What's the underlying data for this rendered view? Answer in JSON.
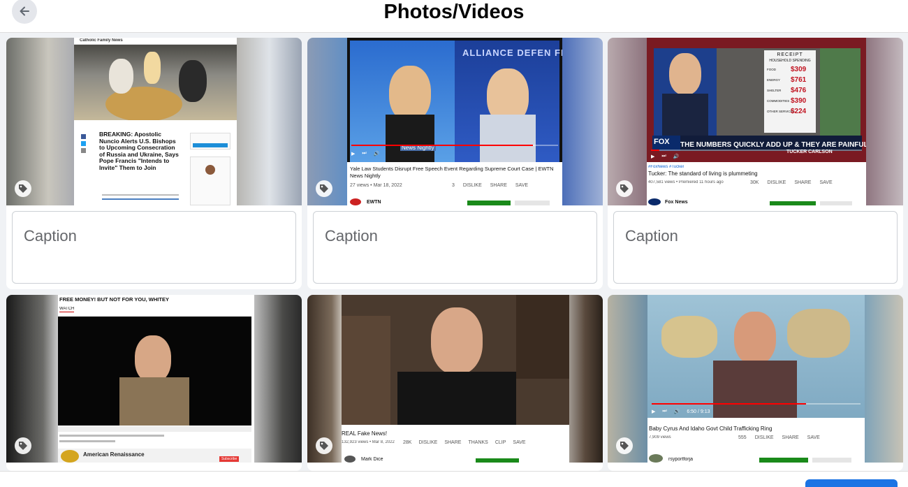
{
  "header": {
    "title": "Photos/Videos",
    "back_icon": "arrow-left-icon"
  },
  "caption_placeholder": "Caption",
  "cards": [
    {
      "headline": "BREAKING: Apostolic Nuncio Alerts U.S. Bishops to Upcoming Consecration of Russia and Ukraine, Says Pope Francis \"Intends to Invite\" Them to Join",
      "site": "Catholic Family News"
    },
    {
      "video_title": "Yale Law Students Disrupt Free Speech Event Regarding Supreme Court Case | EWTN News Nightly",
      "meta": "27 views • Mar 18, 2022",
      "overlay": "ALLIANCE DEFEN FREEDO",
      "lower_third": "News Nightly",
      "channel": "EWTN",
      "likes": "3",
      "actions": [
        "DISLIKE",
        "SHARE",
        "SAVE"
      ]
    },
    {
      "video_title": "Tucker: The standard of living is plummeting",
      "hashtags": "#FoxNews #Tucker",
      "meta": "407,581 views • Premiered 11 hours ago",
      "chyron": "THE NUMBERS QUICKLY ADD UP & THEY ARE PAINFUL",
      "chyron_sub": "TUCKER CARLSON",
      "channel": "Fox News",
      "likes": "30K",
      "actions": [
        "DISLIKE",
        "SHARE",
        "SAVE"
      ],
      "receipt": {
        "title": "RECEIPT",
        "subtitle": "HOUSEHOLD SPENDING",
        "rows": [
          {
            "label": "FOOD",
            "value": "$309"
          },
          {
            "label": "ENERGY",
            "value": "$761"
          },
          {
            "label": "SHELTER",
            "value": "$476"
          },
          {
            "label": "COMMODITIES",
            "value": "$390"
          },
          {
            "label": "OTHER SERVICES",
            "value": "$224"
          }
        ]
      }
    },
    {
      "banner": "FREE MONEY! BUT NOT FOR YOU, WHITEY",
      "tab": "WATCH",
      "channel": "American Renaissance",
      "subscribe": "Subscribe"
    },
    {
      "video_title": "REAL Fake News!",
      "meta": "132,923 views • Mar 8, 2022",
      "likes": "28K",
      "actions": [
        "DISLIKE",
        "SHARE",
        "THANKS",
        "CLIP",
        "SAVE"
      ],
      "channel": "Mark Dice"
    },
    {
      "video_title": "Baby Cyrus And Idaho Govt Child Trafficking Ring",
      "meta": "7,909 views",
      "likes": "555",
      "actions": [
        "DISLIKE",
        "SHARE",
        "SAVE"
      ],
      "channel": "rsyportforja",
      "time": "6:50 / 9:13"
    }
  ]
}
